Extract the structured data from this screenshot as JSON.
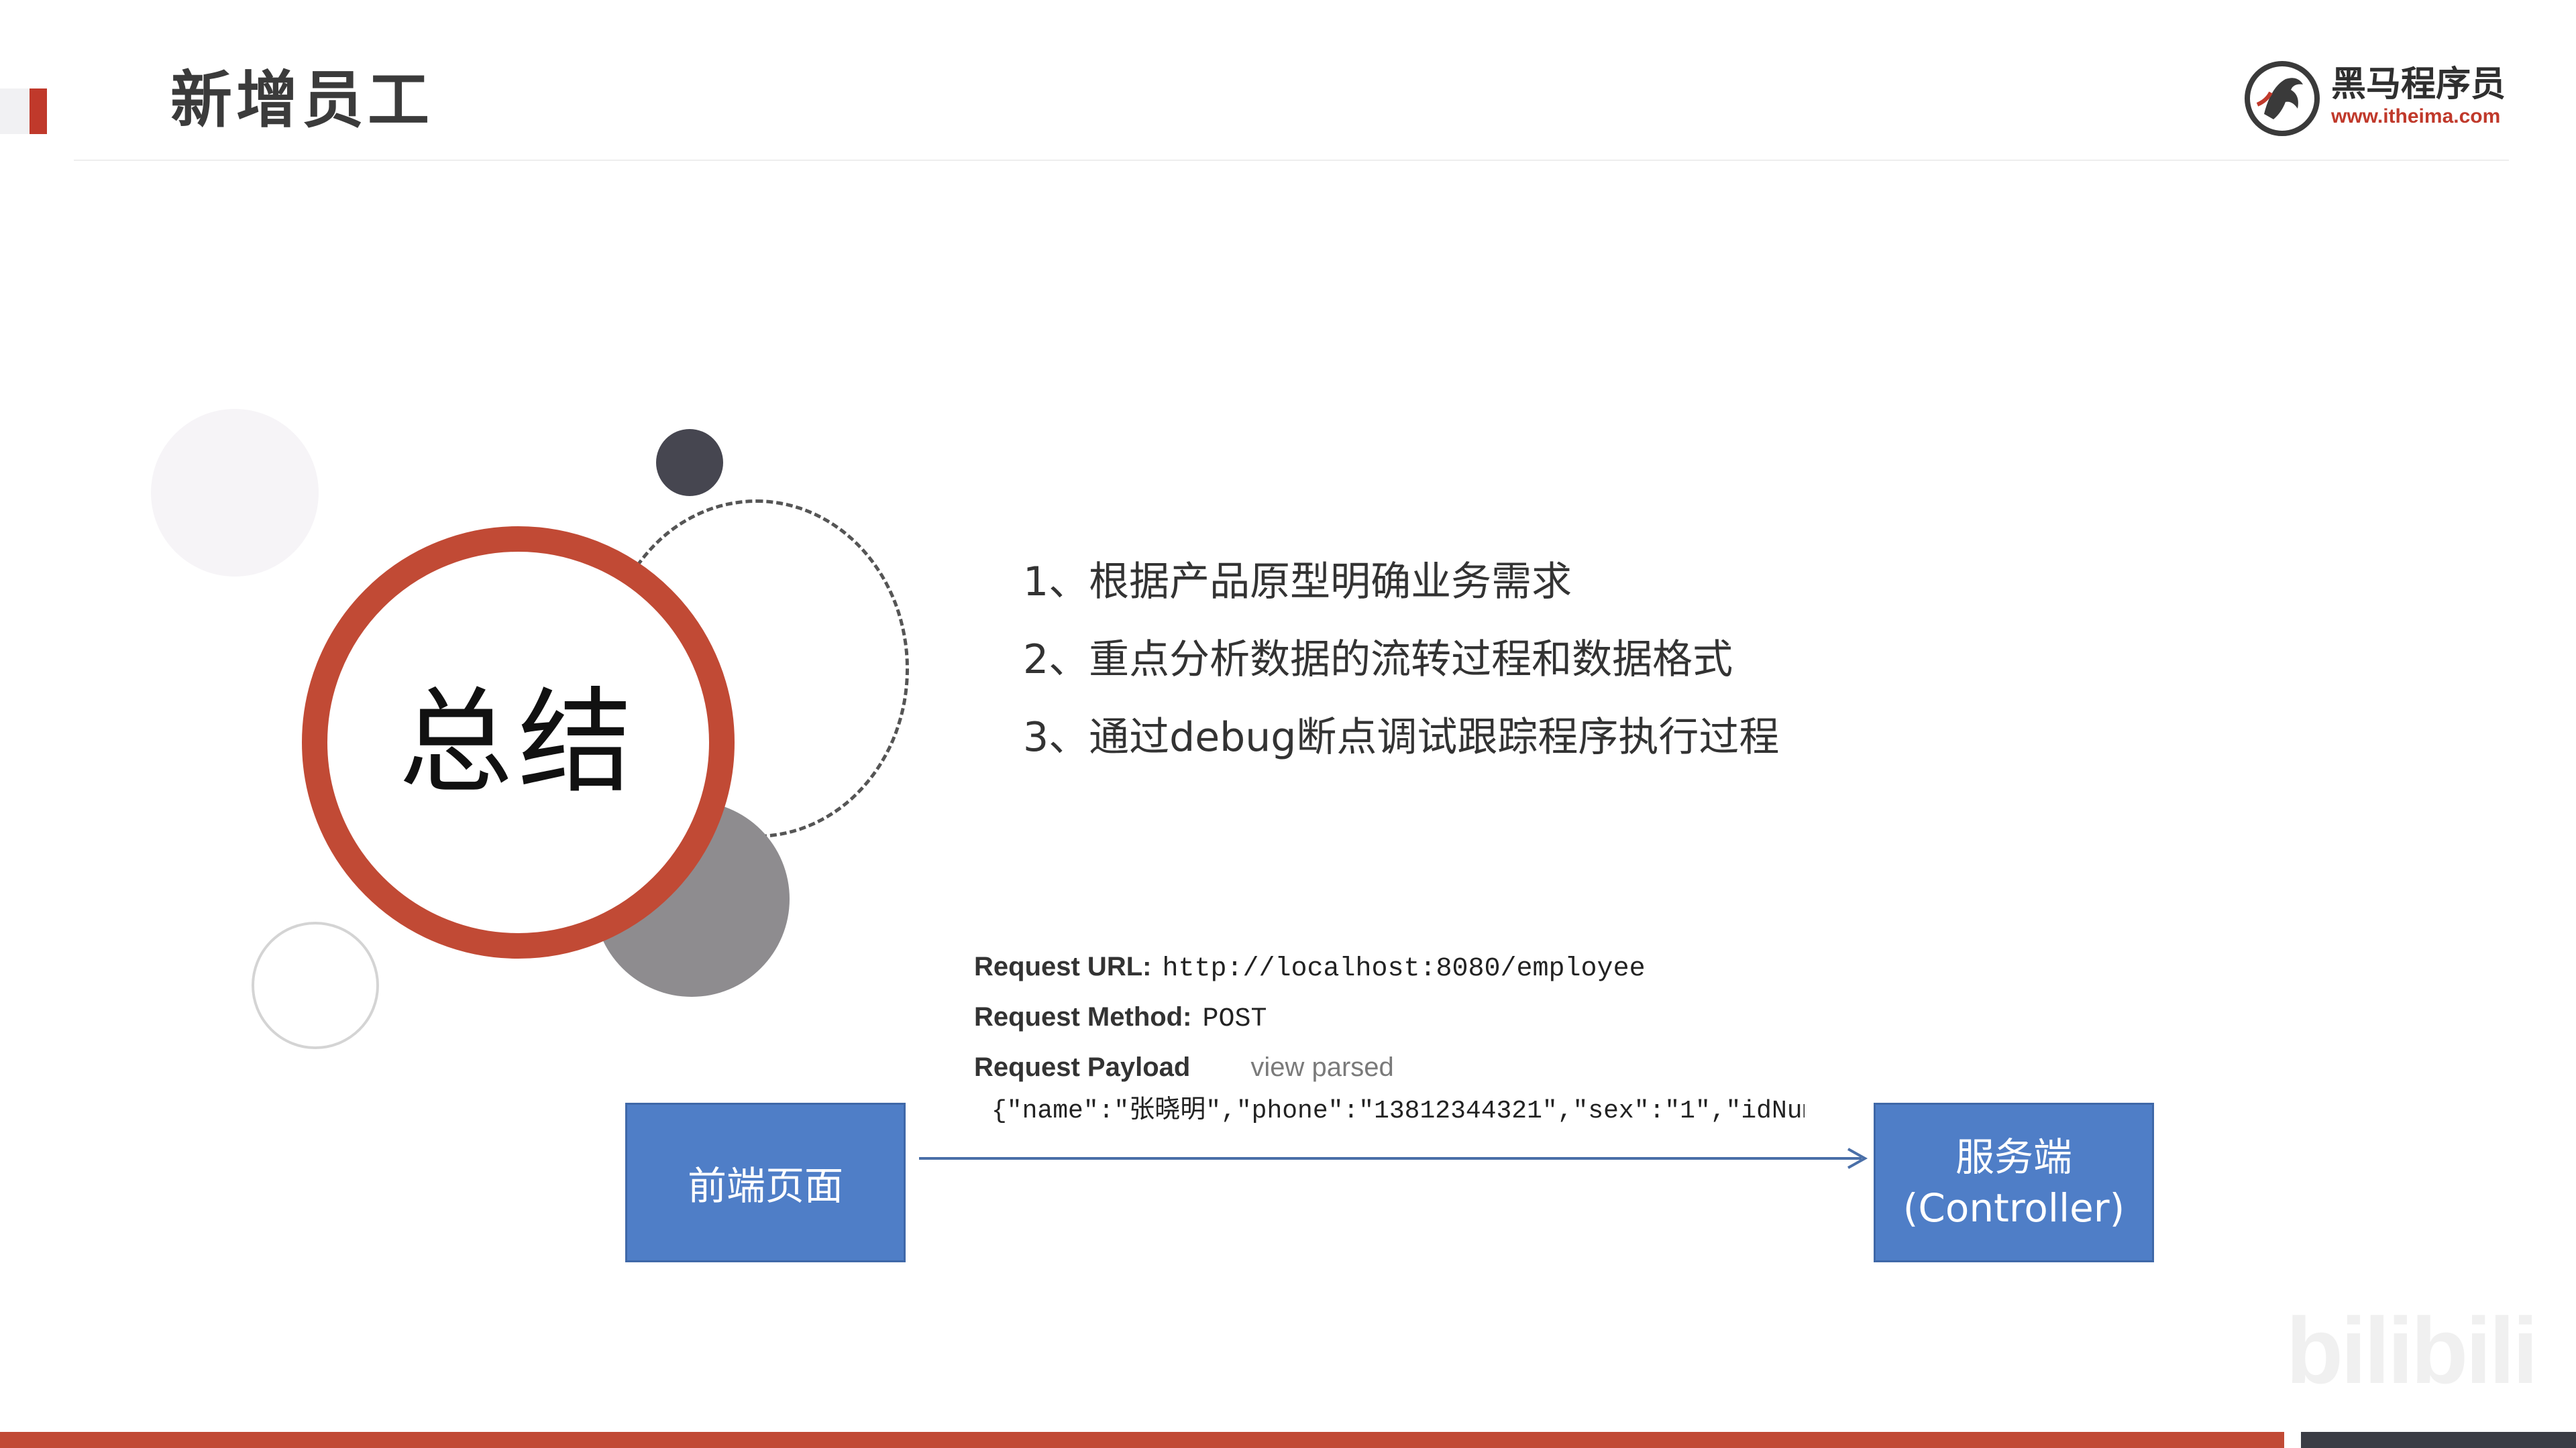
{
  "header": {
    "title": "新增员工"
  },
  "logo": {
    "name": "黑马程序员",
    "url": "www.itheima.com",
    "icon": "horse-logo-icon"
  },
  "summary": {
    "label": "总结"
  },
  "points": [
    "1、根据产品原型明确业务需求",
    "2、重点分析数据的流转过程和数据格式",
    "3、通过debug断点调试跟踪程序执行过程"
  ],
  "request": {
    "url_label": "Request URL:",
    "url_value": "http://localhost:8080/employee",
    "method_label": "Request Method:",
    "method_value": "POST",
    "payload_label": "Request Payload",
    "payload_link": "view parsed",
    "payload_value": "{\"name\":\"张晓明\",\"phone\":\"13812344321\",\"sex\":\"1\",\"idNumb"
  },
  "flow": {
    "front_label": "前端页面",
    "server_label_line1": "服务端",
    "server_label_line2": "(Controller)"
  },
  "watermark": {
    "text": "bilibili"
  },
  "colors": {
    "accent_red": "#c14a35",
    "box_blue": "#4f7ec7",
    "dark_grey": "#3b3d45"
  }
}
